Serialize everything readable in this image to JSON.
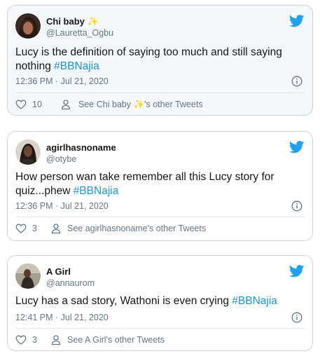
{
  "tweets": [
    {
      "display_name": "Chi baby",
      "name_emoji": "✨",
      "handle": "@Lauretta_Ogbu",
      "text": "Lucy is the definition of saying too much and still saying nothing ",
      "hashtag": "#BBNajia",
      "timestamp": "12:36 PM · Jul 21, 2020",
      "like_count": "10",
      "other_prefix": "See Chi baby ",
      "other_emoji": "✨",
      "other_suffix": "'s other Tweets"
    },
    {
      "display_name": "agirlhasnoname",
      "handle": "@otybe",
      "text": "How person wan take remember all this Lucy story for quiz...phew ",
      "hashtag": "#BBNajia",
      "timestamp": "12:36 PM · Jul 21, 2020",
      "like_count": "3",
      "other_label": "See agirlhasnoname's other Tweets"
    },
    {
      "display_name": "A Girl",
      "handle": "@annaurom",
      "text": "Lucy has a sad story, Wathoni is even crying ",
      "hashtag": "#BBNajia",
      "timestamp": "12:41 PM · Jul 21, 2020",
      "like_count": "3",
      "other_label": "See A Girl's other Tweets"
    }
  ],
  "colors": {
    "twitter_blue": "#1da1f2",
    "hashtag": "#1b95e0",
    "muted": "#657786",
    "border": "#ccd6dd"
  },
  "icons": [
    "twitter-bird-icon",
    "info-icon",
    "heart-icon",
    "person-icon"
  ]
}
